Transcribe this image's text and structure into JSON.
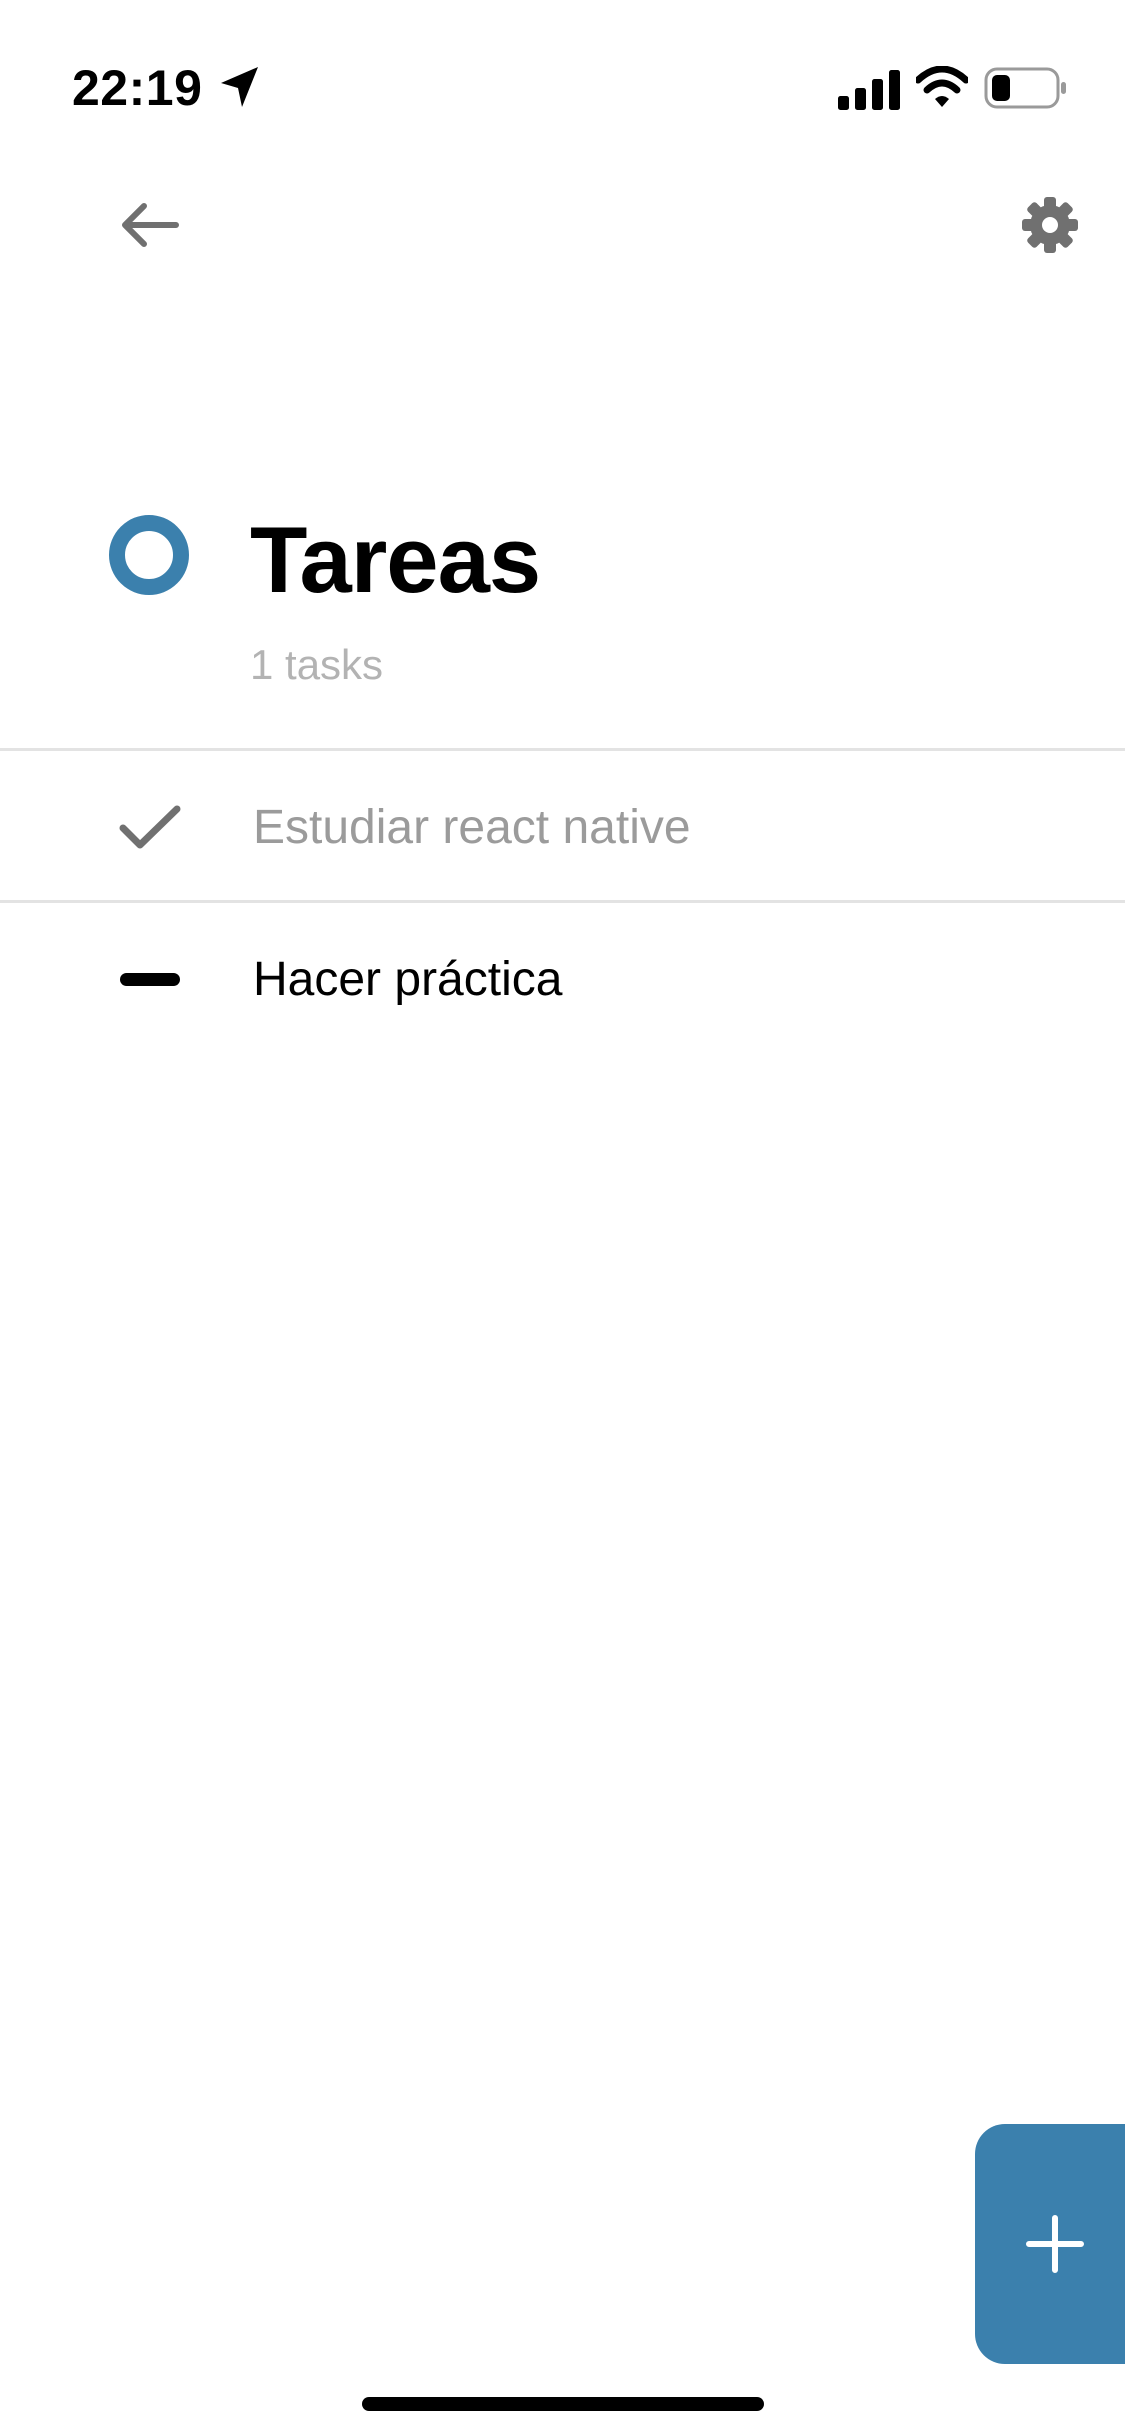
{
  "status_bar": {
    "time": "22:19",
    "icons": [
      "location-arrow-icon",
      "cellular-signal-icon",
      "wifi-icon",
      "battery-icon"
    ]
  },
  "header": {
    "back_icon": "arrow-left-icon",
    "settings_icon": "gear-icon"
  },
  "list": {
    "title": "Tareas",
    "count_label": "1 tasks",
    "accent_color": "#3b80ad"
  },
  "tasks": [
    {
      "label": "Estudiar react native",
      "status": "completed",
      "icon": "checkmark-icon"
    },
    {
      "label": "Hacer práctica",
      "status": "pending",
      "icon": "dash-icon"
    }
  ],
  "fab": {
    "icon": "plus-icon",
    "color": "#3b80ad"
  }
}
